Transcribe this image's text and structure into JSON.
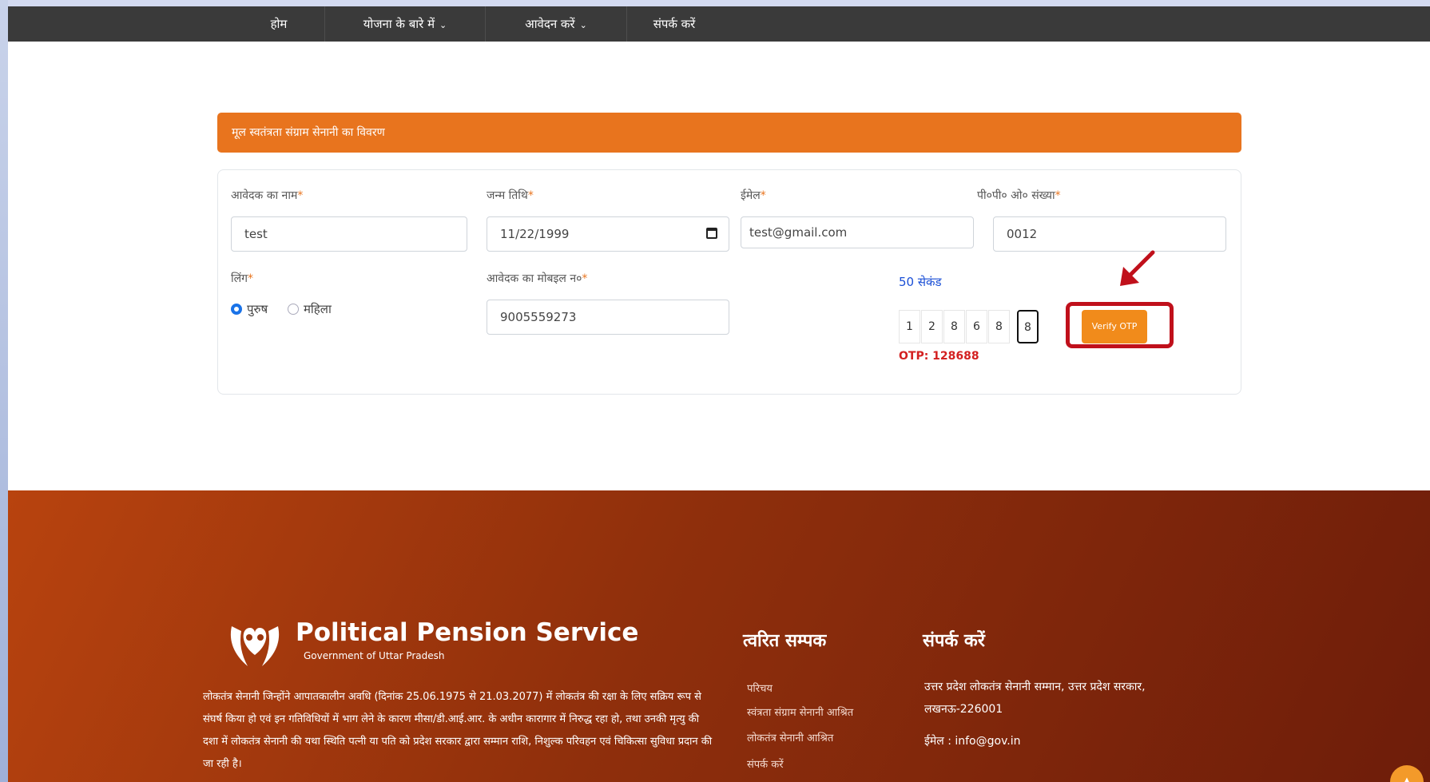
{
  "nav": {
    "items": [
      {
        "label": "होम"
      },
      {
        "label": "योजना के बारे में"
      },
      {
        "label": "आवेदन करें"
      },
      {
        "label": "संपर्क करें"
      }
    ]
  },
  "form": {
    "header": "मूल स्वतंत्रता संग्राम सेनानी का विवरण",
    "applicant_name": {
      "label": "आवेदक का नाम",
      "value": "test"
    },
    "dob": {
      "label": "जन्म तिथि",
      "value": "11/22/1999"
    },
    "email": {
      "label": "ईमेल",
      "value": "test@gmail.com"
    },
    "ppo": {
      "label": "पी०पी० ओ० संख्या",
      "value": "0012"
    },
    "gender": {
      "label": "लिंग",
      "options": [
        "पुरुष",
        "महिला"
      ],
      "selected": "पुरुष"
    },
    "mobile": {
      "label": "आवेदक का मोबइल न०",
      "value": "9005559273"
    },
    "otp": {
      "timer": "50 सेकंड",
      "digits": [
        "1",
        "2",
        "8",
        "6",
        "8",
        "8"
      ],
      "verify_label": "Verify OTP",
      "note": "OTP: 128688"
    }
  },
  "footer": {
    "logo_title": "Political Pension Service",
    "logo_subtitle": "Government of Uttar Pradesh",
    "description": "लोकतंत्र सेनानी जिन्होंने आपातकालीन अवधि (दिनांक 25.06.1975 से 21.03.2077) में लोकतंत्र की रक्षा के लिए सक्रिय रूप से संघर्ष किया हो एवं इन गतिविधियों में भाग लेने के कारण मीसा/डी.आई.आर. के अधीन कारागार में निरुद्ध रहा हो, तथा उनकी मृत्यु की दशा में लोकतंत्र सेनानी की यथा स्थिति पत्नी या पति को प्रदेश सरकार द्वारा सम्मान राशि, निशुल्क परिवहन एवं चिकित्सा सुविधा प्रदान की जा रही है।",
    "quick_links_title": "त्वरित सम्पक",
    "quick_links": [
      "परिचय",
      "स्वंत्रता संग्राम सेनानी आश्रित",
      "लोकतंत्र सेनानी आश्रित",
      "संपर्क करें"
    ],
    "contact_title": "संपर्क करें",
    "contact_address": "उत्तर प्रदेश लोकतंत्र सेनानी सम्मान, उत्तर प्रदेश सरकार, लखनऊ-226001",
    "contact_email": "ईमेल : info@gov.in"
  },
  "colors": {
    "accent": "#e8741e",
    "nav_bg": "#3a3a3a",
    "highlight": "#c0101b",
    "otp_note": "#d32020"
  }
}
